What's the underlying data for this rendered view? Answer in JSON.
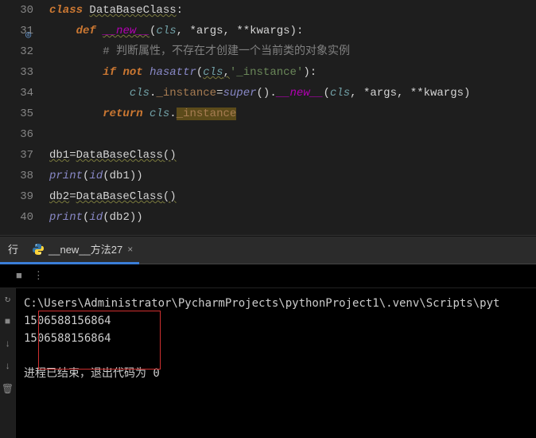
{
  "editor": {
    "lines": [
      {
        "num": "30"
      },
      {
        "num": "31"
      },
      {
        "num": "32"
      },
      {
        "num": "33"
      },
      {
        "num": "34"
      },
      {
        "num": "35"
      },
      {
        "num": "36"
      },
      {
        "num": "37"
      },
      {
        "num": "38"
      },
      {
        "num": "39"
      },
      {
        "num": "40"
      }
    ],
    "tokens": {
      "class_kw": "class",
      "class_name": "DataBaseClass",
      "colon": ":",
      "def_kw": "def",
      "new": "__new__",
      "lparen": "(",
      "rparen": ")",
      "cls": "cls",
      "comma_sp": ", ",
      "star_args": "*args",
      "dstar_kwargs": "**kwargs",
      "comment1a": "# ",
      "comment1b": "判断属性，不存在才创建一个当前类的对象实例",
      "if_kw": "if",
      "not_kw": "not",
      "hasattr": "hasattr",
      "instance_str": "'_instance'",
      "dot": ".",
      "instance_attr": "_instance",
      "eq": "=",
      "super": "super",
      "return_kw": "return",
      "db1": "db1",
      "db2": "db2",
      "print": "print",
      "id": "id"
    }
  },
  "panel": {
    "run_label": "行",
    "tab_name": "__new__方法27",
    "toolbar": {
      "stop": "■",
      "more": "⋮"
    }
  },
  "console": {
    "path": "C:\\Users\\Administrator\\PycharmProjects\\pythonProject1\\.venv\\Scripts\\pyt",
    "out1": "1506588156864",
    "out2": "1506588156864",
    "exit": "进程已结束，退出代码为 0"
  },
  "icons": {
    "target": "◎",
    "restart": "↻",
    "stop": "■",
    "down": "↓",
    "trash": "🗑"
  }
}
